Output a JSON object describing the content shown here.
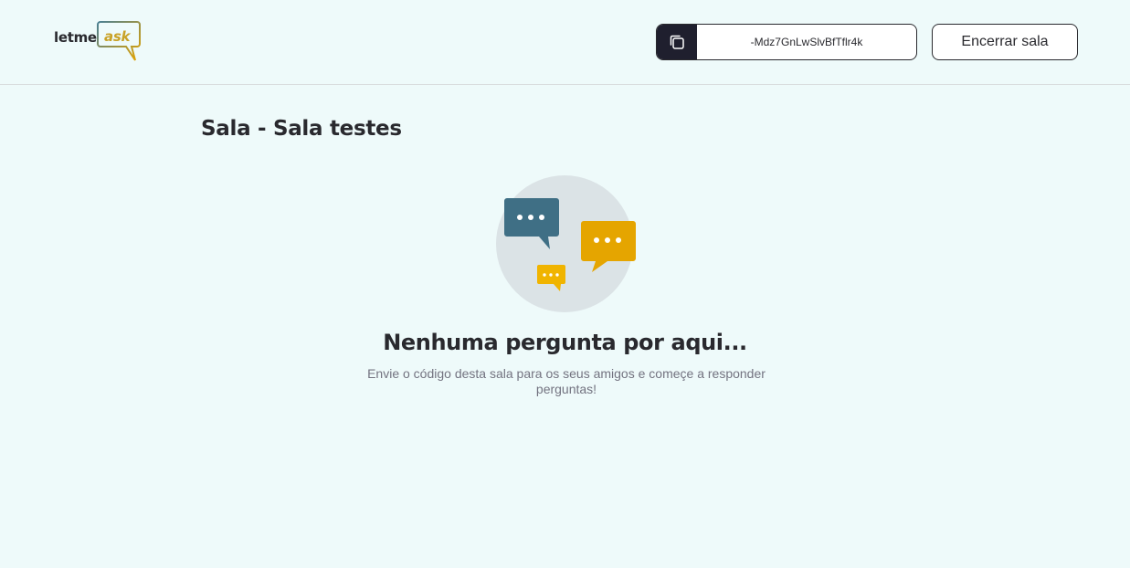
{
  "header": {
    "logo": {
      "part1": "letme",
      "part2": "ask"
    },
    "room_code": {
      "value": "-Mdz7GnLwSlvBfTflr4k",
      "copy_icon": "copy-icon"
    },
    "close_label": "Encerrar sala"
  },
  "main": {
    "title": "Sala - Sala testes",
    "empty_state": {
      "illustration": "empty-questions-illustration",
      "title": "Nenhuma pergunta por aqui...",
      "text": "Envie o código desta sala para os seus amigos e começe a responder perguntas!"
    }
  },
  "colors": {
    "background": "#eefafa",
    "dark": "#29292e",
    "accent_yellow": "#e5a500",
    "accent_blue": "#3f6f85"
  }
}
